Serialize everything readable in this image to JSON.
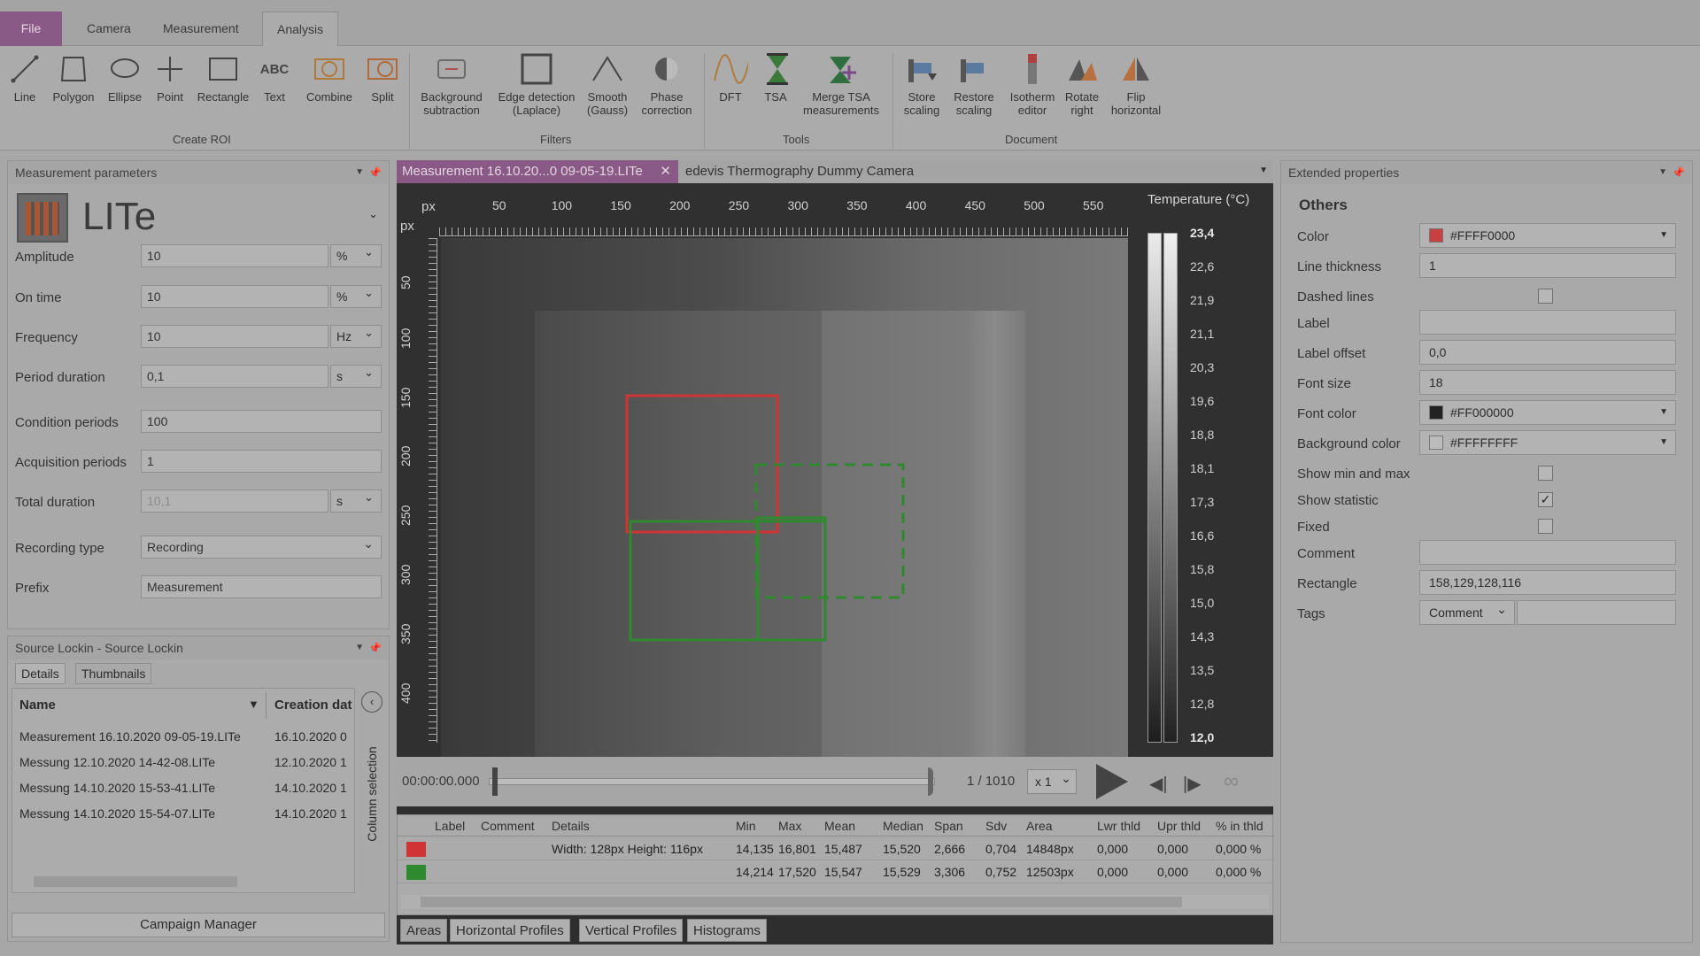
{
  "ribbon_tabs": [
    "File",
    "Camera",
    "Measurement",
    "Analysis"
  ],
  "ribbon": {
    "roi_buttons": [
      "Line",
      "Polygon",
      "Ellipse",
      "Point",
      "Rectangle",
      "Text",
      "Combine",
      "Split"
    ],
    "roi_group": "Create ROI",
    "filter_buttons": [
      "Background subtraction",
      "Edge detection (Laplace)",
      "Smooth (Gauss)",
      "Phase correction"
    ],
    "filter_group": "Filters",
    "tool_buttons": [
      "DFT",
      "TSA",
      "Merge TSA measurements"
    ],
    "tool_group": "Tools",
    "doc_buttons": [
      "Store scaling",
      "Restore scaling",
      "Isotherm editor",
      "Rotate right",
      "Flip horizontal"
    ],
    "doc_group": "Document"
  },
  "meas_params": {
    "title": "Measurement parameters",
    "device": "LITe",
    "rows": [
      {
        "label": "Amplitude",
        "value": "10",
        "unit": "%"
      },
      {
        "label": "On time",
        "value": "10",
        "unit": "%"
      },
      {
        "label": "Frequency",
        "value": "10",
        "unit": "Hz"
      },
      {
        "label": "Period duration",
        "value": "0,1",
        "unit": "s"
      },
      {
        "label": "Condition periods",
        "value": "100",
        "unit": ""
      },
      {
        "label": "Acquisition periods",
        "value": "1",
        "unit": ""
      },
      {
        "label": "Total duration",
        "value": "10,1",
        "unit": "s"
      },
      {
        "label": "Recording type",
        "value": "Recording",
        "unit": ""
      },
      {
        "label": "Prefix",
        "value": "Measurement",
        "unit": ""
      }
    ]
  },
  "source": {
    "title": "Source Lockin - Source Lockin",
    "tabs": [
      "Details",
      "Thumbnails"
    ],
    "col_name": "Name",
    "col_date": "Creation dat",
    "column_selection": "Column selection",
    "files": [
      {
        "name": "Measurement 16.10.2020 09-05-19.LITe",
        "date": "16.10.2020 0"
      },
      {
        "name": "Messung 12.10.2020 14-42-08.LITe",
        "date": "12.10.2020 1"
      },
      {
        "name": "Messung 14.10.2020 15-53-41.LITe",
        "date": "14.10.2020 1"
      },
      {
        "name": "Messung 14.10.2020 15-54-07.LITe",
        "date": "14.10.2020 1"
      }
    ],
    "campaign_button": "Campaign Manager"
  },
  "viewer": {
    "doc_tab": "Measurement 16.10.20...0 09-05-19.LITe",
    "camera_tab": "edevis Thermography Dummy Camera",
    "unit_px": "px",
    "x_ticks": [
      "50",
      "100",
      "150",
      "200",
      "250",
      "300",
      "350",
      "400",
      "450",
      "500",
      "550"
    ],
    "y_ticks": [
      "50",
      "100",
      "150",
      "200",
      "250",
      "300",
      "350",
      "400"
    ],
    "temp_title": "Temperature (°C)",
    "temp_scale": [
      "23,4",
      "22,6",
      "21,9",
      "21,1",
      "20,3",
      "19,6",
      "18,8",
      "18,1",
      "17,3",
      "16,6",
      "15,8",
      "15,0",
      "14,3",
      "13,5",
      "12,8",
      "12,0"
    ],
    "time": "00:00:00.000",
    "frame": "1 / 1010",
    "speed": "x 1",
    "colors": {
      "roi_red": "#d03434",
      "roi_green": "#2f8a2f"
    }
  },
  "stats": {
    "headers": [
      "Label",
      "Comment",
      "Details",
      "Min",
      "Max",
      "Mean",
      "Median",
      "Span",
      "Sdv",
      "Area",
      "Lwr thld",
      "Upr thld",
      "% in thld"
    ],
    "rows": [
      {
        "details": "Width: 128px Height: 116px",
        "min": "14,135",
        "max": "16,801",
        "mean": "15,487",
        "median": "15,520",
        "span": "2,666",
        "sdv": "0,704",
        "area": "14848px",
        "lwr": "0,000",
        "upr": "0,000",
        "pct": "0,000 %"
      },
      {
        "details": "",
        "min": "14,214",
        "max": "17,520",
        "mean": "15,547",
        "median": "15,529",
        "span": "3,306",
        "sdv": "0,752",
        "area": "12503px",
        "lwr": "0,000",
        "upr": "0,000",
        "pct": "0,000 %"
      }
    ],
    "bottom_tabs": [
      "Areas",
      "Horizontal Profiles",
      "Vertical Profiles",
      "Histograms"
    ]
  },
  "ext_props": {
    "title": "Extended properties",
    "section": "Others",
    "color_label": "Color",
    "color_value": "#FFFF0000",
    "thick_label": "Line thickness",
    "thick_value": "1",
    "dashed_label": "Dashed lines",
    "label_label": "Label",
    "offset_label": "Label offset",
    "offset_value": "0,0",
    "fsize_label": "Font size",
    "fsize_value": "18",
    "fcolor_label": "Font color",
    "fcolor_value": "#FF000000",
    "bg_label": "Background color",
    "bg_value": "#FFFFFFFF",
    "minmax_label": "Show min and max",
    "stat_label": "Show statistic",
    "fixed_label": "Fixed",
    "comment_label": "Comment",
    "rect_label": "Rectangle",
    "rect_value": "158,129,128,116",
    "tags_label": "Tags",
    "tags_value": "Comment"
  }
}
